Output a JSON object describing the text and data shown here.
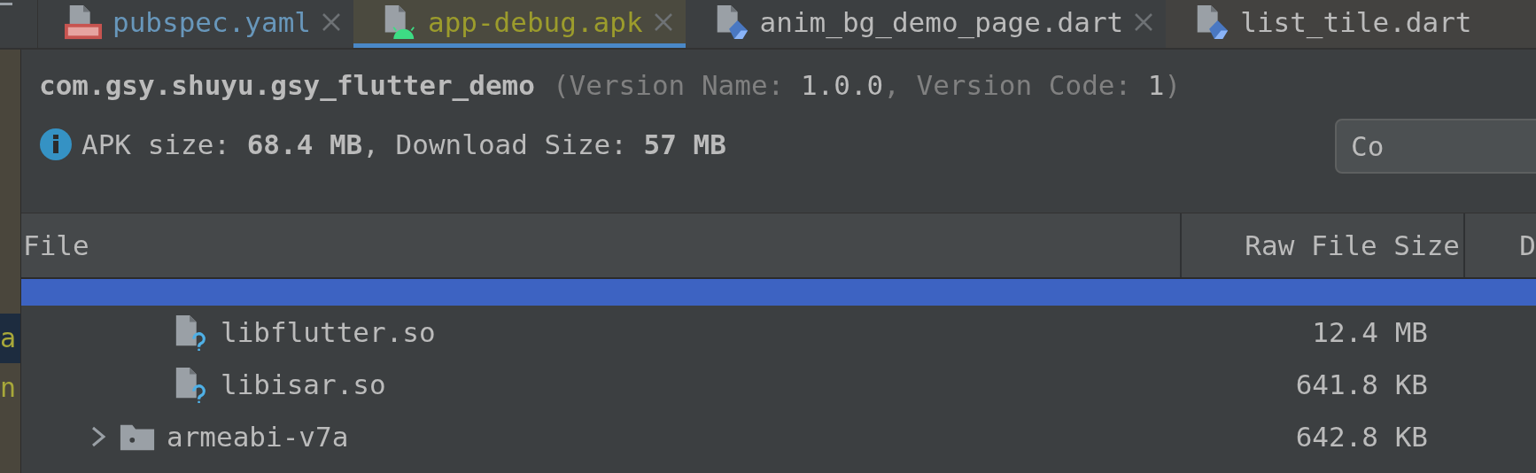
{
  "tabs": [
    {
      "label": "pubspec.yaml",
      "kind": "yaml",
      "selected": false,
      "closable": true
    },
    {
      "label": "app-debug.apk",
      "kind": "apk",
      "selected": true,
      "closable": true
    },
    {
      "label": "anim_bg_demo_page.dart",
      "kind": "dart",
      "selected": false,
      "closable": true
    },
    {
      "label": "list_tile.dart",
      "kind": "dart",
      "selected": false,
      "closable": false
    }
  ],
  "gutter": [
    "a",
    "n"
  ],
  "apk": {
    "package": "com.gsy.shuyu.gsy_flutter_demo",
    "version": "(Version Name: **1.0.0**, Version Code: **1**)",
    "size_info": "APK size: **68.4 MB**, Download Size: **57 MB**",
    "button": "Co"
  },
  "table": {
    "columns": [
      "File",
      "Raw File Size",
      "D"
    ],
    "rows": [
      {
        "selected": true,
        "children": [
          {
            "kind": "unknown-file",
            "name": "libflutter.so",
            "size": "12.4 MB",
            "selected": false
          },
          {
            "kind": "unknown-file",
            "name": "libisar.so",
            "size": "641.8 KB",
            "selected": false
          }
        ]
      },
      {
        "kind": "folder",
        "name": "armeabi-v7a",
        "size": "642.8 KB",
        "selected": false,
        "expanded": false
      }
    ]
  }
}
